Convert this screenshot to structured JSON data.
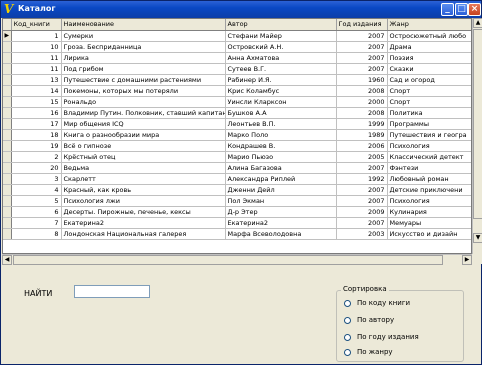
{
  "window": {
    "title": "Каталог"
  },
  "columns": [
    "Код_книги",
    "Наименование",
    "Автор",
    "Год издания",
    "Жанр"
  ],
  "rows": [
    {
      "id": "1",
      "title": "Сумерки",
      "author": "Стефани Майер",
      "year": "2007",
      "genre": "Остросюжетный любо"
    },
    {
      "id": "10",
      "title": "Гроза. Бесприданница",
      "author": "Островский А.Н.",
      "year": "2007",
      "genre": "Драма"
    },
    {
      "id": "11",
      "title": "Лирика",
      "author": "Анна Ахматова",
      "year": "2007",
      "genre": "Поэзия"
    },
    {
      "id": "11",
      "title": "Под грибом",
      "author": "Сутеев В.Г.",
      "year": "2007",
      "genre": "Сказки"
    },
    {
      "id": "13",
      "title": "Путешествие с домашними растениями",
      "author": "Рабинер И.Я.",
      "year": "1960",
      "genre": "Сад и огород"
    },
    {
      "id": "14",
      "title": "Покемоны, которых мы потеряли",
      "author": "Крис Коламбус",
      "year": "2008",
      "genre": "Спорт"
    },
    {
      "id": "15",
      "title": "Рональдо",
      "author": "Уинсли Кларксон",
      "year": "2000",
      "genre": "Спорт"
    },
    {
      "id": "16",
      "title": "Владимир Путин. Полковник, ставший капитаном",
      "author": "Бушков А.А",
      "year": "2008",
      "genre": "Политика"
    },
    {
      "id": "17",
      "title": "Мир общения ICQ",
      "author": "Леонтьев В.П.",
      "year": "1999",
      "genre": "Программы"
    },
    {
      "id": "18",
      "title": "Книга о разнообразии мира",
      "author": "Марко Поло",
      "year": "1989",
      "genre": "Путешествия и геогра"
    },
    {
      "id": "19",
      "title": "Всё о гипнозе",
      "author": "Кондрашев В.",
      "year": "2006",
      "genre": "Психология"
    },
    {
      "id": "2",
      "title": "Крёстный отец",
      "author": "Марио Пьюзо",
      "year": "2005",
      "genre": "Классический детект"
    },
    {
      "id": "20",
      "title": "Ведьма",
      "author": "Алина Багазова",
      "year": "2007",
      "genre": "Фэнтези"
    },
    {
      "id": "3",
      "title": "Скарлетт",
      "author": "Александра Риплей",
      "year": "1992",
      "genre": "Любовный роман"
    },
    {
      "id": "4",
      "title": "Красный, как кровь",
      "author": "Дженни Дейл",
      "year": "2007",
      "genre": "Детские приключени"
    },
    {
      "id": "5",
      "title": "Психология лжи",
      "author": "Пол Экман",
      "year": "2007",
      "genre": "Психология"
    },
    {
      "id": "6",
      "title": "Десерты. Пирожные, печенье, кексы",
      "author": "Д-р Этер",
      "year": "2009",
      "genre": "Кулинария"
    },
    {
      "id": "7",
      "title": "Екатерина2",
      "author": "Екатерина2",
      "year": "2007",
      "genre": "Мемуары"
    },
    {
      "id": "8",
      "title": "Лондонская Национальная галерея",
      "author": "Марфа Всеволодовна",
      "year": "2003",
      "genre": "Искусство и дизайн"
    }
  ],
  "find": {
    "label": "НАЙТИ",
    "value": ""
  },
  "sort": {
    "legend": "Сортировка",
    "options": [
      "По коду книги",
      "По автору",
      "По году издания",
      "По жанру"
    ]
  },
  "colors": {
    "title_bar": "#0a48c4",
    "window_bg": "#ece9d8"
  }
}
